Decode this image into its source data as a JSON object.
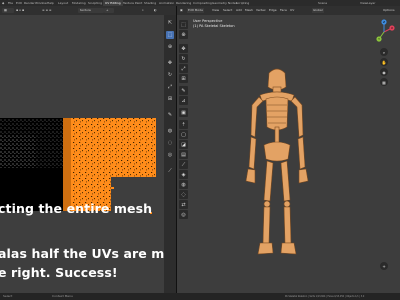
{
  "top_bar": {
    "menus": [
      "File",
      "Edit",
      "Render",
      "Window",
      "Help"
    ],
    "tabs": [
      "Layout",
      "Modeling",
      "Sculpting",
      "UV Editing",
      "Texture Paint",
      "Shading",
      "Animation",
      "Rendering",
      "Compositing",
      "Geometry Nodes",
      "Scripting"
    ],
    "active_tab": "UV Editing",
    "scene": "Scene",
    "view_layer": "ViewLayer"
  },
  "uv_editor": {
    "image_name": "texture"
  },
  "viewport": {
    "mode": "Edit Mode",
    "menus": [
      "View",
      "Select",
      "Add",
      "Mesh",
      "Vertex",
      "Edge",
      "Face",
      "UV"
    ],
    "orientation": "Global",
    "options_label": "Options",
    "perspective_label": "User Perspective",
    "object_label": "(1) PA Skeletal Skeleton",
    "gizmo": {
      "x": "X",
      "y": "Y",
      "z": "Z"
    }
  },
  "caption": {
    "line1": "cting the entire mesh",
    "line2": "alas half the UVs are moved",
    "line3": "e right. Success!"
  },
  "status_bar": {
    "left": "Select",
    "mid": "Context Menu",
    "right": "PA Skeletal Skeleton | Verts 1/13,604 | Faces 0/13,256 | Objects 1/1 | 3.0"
  },
  "colors": {
    "uv_island": "#ff8c1a",
    "viewport_bg": "#3d3d3d",
    "active_tool": "#4772b3",
    "mesh": "#e3a264"
  },
  "icons": {
    "uv_tools": [
      "cursor-icon",
      "select-box-icon",
      "cursor-3d-icon",
      "move-icon",
      "rotate-icon",
      "scale-icon",
      "transform-icon",
      "annotate-icon",
      "grab-icon",
      "relax-icon",
      "pinch-icon",
      "rip-icon"
    ],
    "viewport_tools": [
      "select-box-icon",
      "cursor-icon",
      "move-icon",
      "rotate-icon",
      "scale-icon",
      "transform-icon",
      "annotate-icon",
      "measure-icon",
      "add-cube-icon",
      "extrude-icon",
      "inset-icon",
      "bevel-icon",
      "loop-cut-icon",
      "knife-icon",
      "poly-build-icon",
      "spin-icon",
      "smooth-icon",
      "edge-slide-icon",
      "shrink-fatten-icon",
      "shear-icon",
      "rip-region-icon"
    ]
  }
}
